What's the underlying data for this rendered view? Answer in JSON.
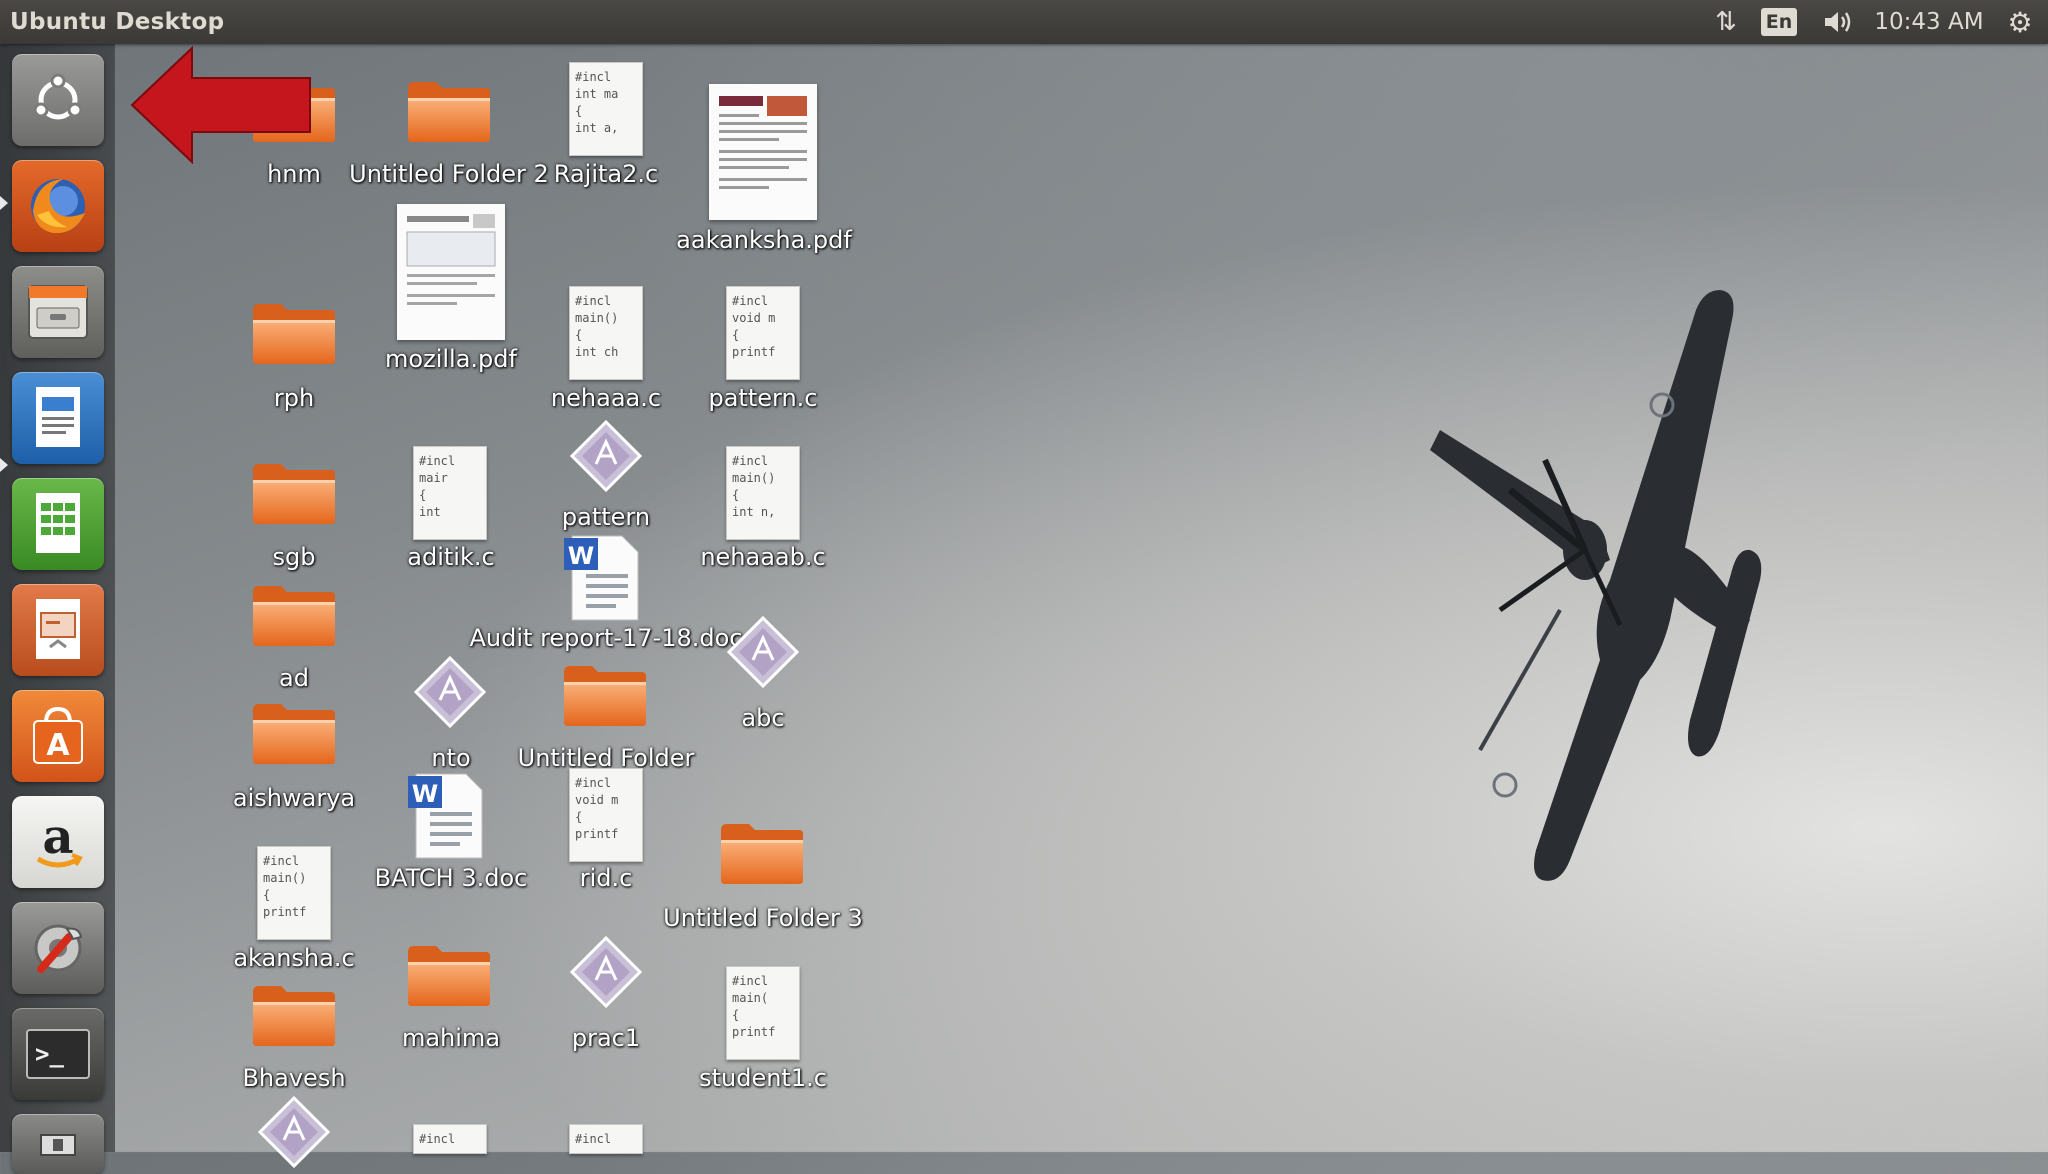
{
  "topbar": {
    "title": "Ubuntu Desktop",
    "network_icon": "network-transfer-icon",
    "language": "En",
    "volume_icon": "speaker-icon",
    "clock": "10:43 AM",
    "system_icon": "gear-icon"
  },
  "launcher": {
    "items": [
      {
        "name": "dash-home",
        "icon": "ubuntu-logo-icon"
      },
      {
        "name": "firefox",
        "icon": "firefox-icon"
      },
      {
        "name": "files",
        "icon": "file-cabinet-icon"
      },
      {
        "name": "libreoffice-writer",
        "icon": "writer-document-icon"
      },
      {
        "name": "libreoffice-calc",
        "icon": "calc-spreadsheet-icon"
      },
      {
        "name": "libreoffice-impress",
        "icon": "impress-presentation-icon"
      },
      {
        "name": "ubuntu-software-center",
        "icon": "software-bag-icon"
      },
      {
        "name": "amazon",
        "icon": "amazon-logo-icon"
      },
      {
        "name": "system-settings",
        "icon": "settings-wrench-icon"
      },
      {
        "name": "terminal",
        "icon": "terminal-icon"
      },
      {
        "name": "more",
        "icon": "app-icon"
      }
    ]
  },
  "desktop_icons": [
    {
      "label": "hnm",
      "type": "folder"
    },
    {
      "label": "Untitled Folder 2",
      "type": "folder"
    },
    {
      "label": "Rajita2.c",
      "type": "c-source"
    },
    {
      "label": "aakanksha.pdf",
      "type": "pdf"
    },
    {
      "label": "mozilla.pdf",
      "type": "pdf"
    },
    {
      "label": "rph",
      "type": "folder"
    },
    {
      "label": "nehaaa.c",
      "type": "c-source"
    },
    {
      "label": "pattern.c",
      "type": "c-source"
    },
    {
      "label": "sgb",
      "type": "folder"
    },
    {
      "label": "aditik.c",
      "type": "c-source"
    },
    {
      "label": "pattern",
      "type": "executable"
    },
    {
      "label": "nehaaab.c",
      "type": "c-source"
    },
    {
      "label": "Audit report-17-18.doc",
      "type": "word-doc"
    },
    {
      "label": "ad",
      "type": "folder"
    },
    {
      "label": "abc",
      "type": "executable"
    },
    {
      "label": "nto",
      "type": "executable"
    },
    {
      "label": "Untitled Folder",
      "type": "folder"
    },
    {
      "label": "aishwarya",
      "type": "folder"
    },
    {
      "label": "BATCH 3.doc",
      "type": "word-doc"
    },
    {
      "label": "rid.c",
      "type": "c-source"
    },
    {
      "label": "Untitled Folder 3",
      "type": "folder"
    },
    {
      "label": "akansha.c",
      "type": "c-source"
    },
    {
      "label": "mahima",
      "type": "folder"
    },
    {
      "label": "prac1",
      "type": "executable"
    },
    {
      "label": "student1.c",
      "type": "c-source"
    },
    {
      "label": "Bhavesh",
      "type": "folder"
    }
  ],
  "code_previews": {
    "rajita2": "#incl\nint ma\n{\nint a,",
    "nehaaa": "#incl\nmain()\n{\nint ch",
    "pattern_c": "#incl\nvoid m\n{\nprintf",
    "aditik": "#incl\nmair\n{\nint",
    "nehaaab": "#incl\nmain()\n{\nint n,",
    "rid": "#incl\nvoid m\n{\nprintf",
    "akansha": "#incl\nmain()\n{\nprintf",
    "student1": "#incl\nmain(\n{\nprintf",
    "partial": "#incl"
  },
  "colors": {
    "folder_orange": "#f07a2a",
    "arrow_red": "#c4161c",
    "panel_dark": "#3c3b37"
  }
}
